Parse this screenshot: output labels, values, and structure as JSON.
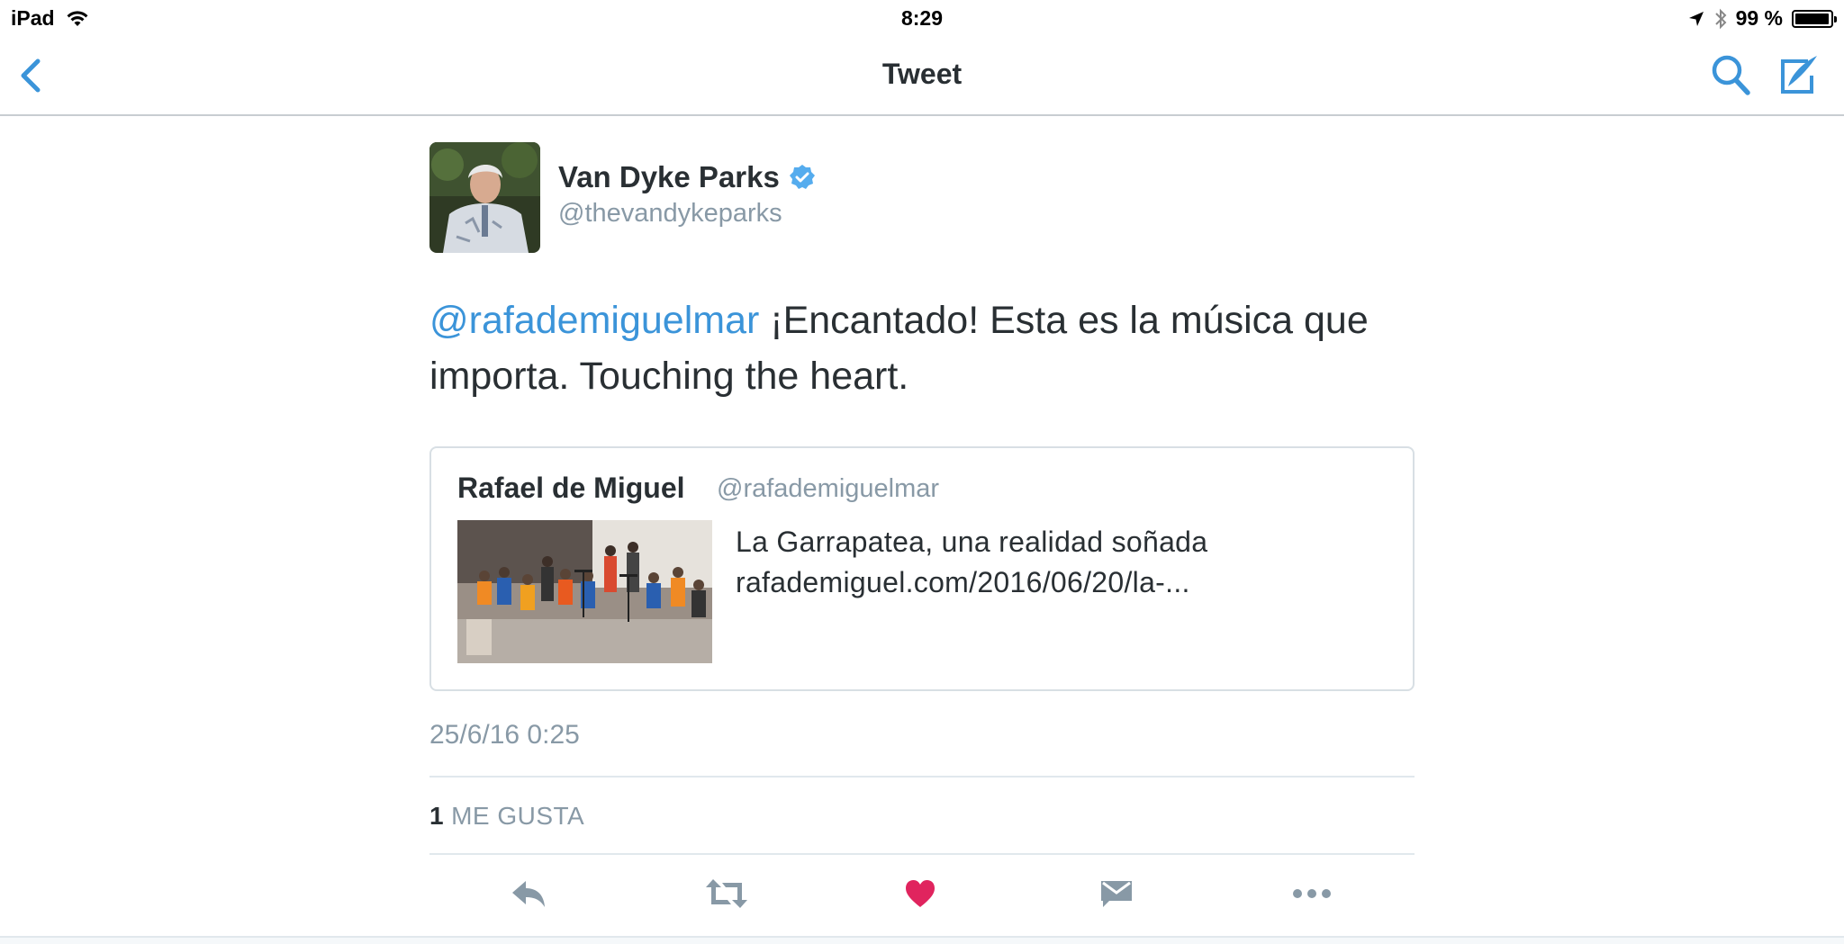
{
  "status_bar": {
    "device": "iPad",
    "time": "8:29",
    "battery_percent": "99 %",
    "battery_level": 0.99
  },
  "nav": {
    "title": "Tweet",
    "icons": [
      "chevron-left-icon",
      "search-icon",
      "compose-icon"
    ],
    "accent_color": "#3b94d9"
  },
  "tweet": {
    "author_name": "Van Dyke Parks",
    "author_handle": "@thevandykeparks",
    "verified": true,
    "mention": "@rafademiguelmar",
    "text": " ¡Encantado! Esta es la música que importa. Touching the heart.",
    "quote": {
      "author_name": "Rafael de Miguel",
      "author_handle": "@rafademiguelmar",
      "title": "La Garrapatea, una realidad soñada",
      "url": "rafademiguel.com/2016/06/20/la-..."
    },
    "timestamp": "25/6/16 0:25",
    "likes_count": "1",
    "likes_label": "ME GUSTA",
    "actions": [
      "reply-icon",
      "retweet-icon",
      "heart-icon",
      "direct-message-icon",
      "more-icon"
    ],
    "like_color": "#e0245e",
    "action_color": "#8899a6"
  }
}
